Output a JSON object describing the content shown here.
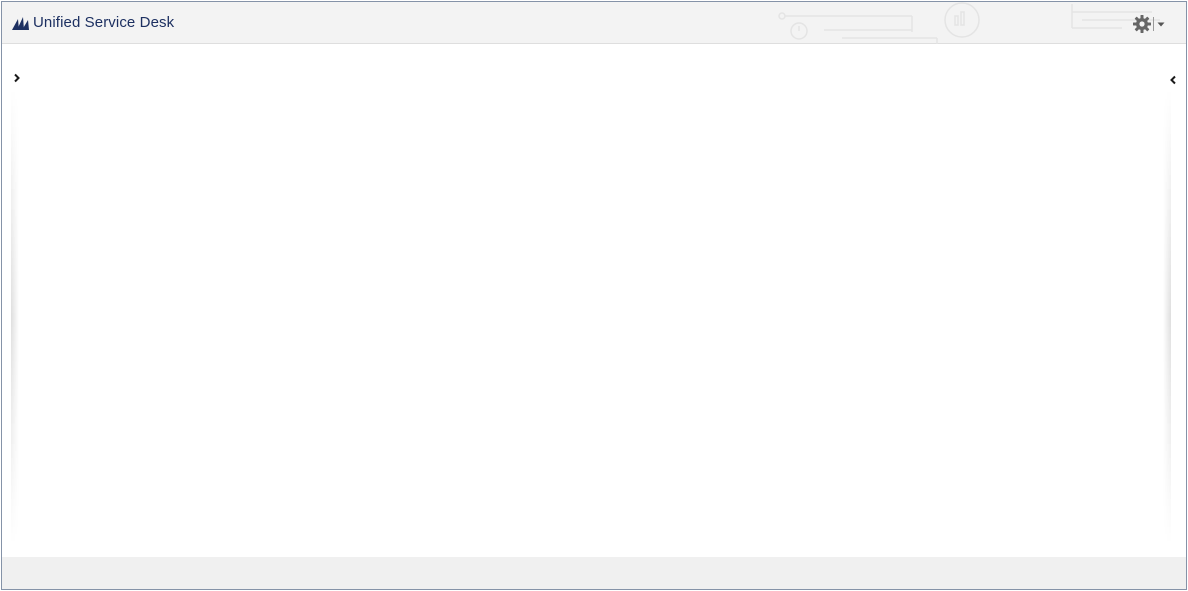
{
  "app": {
    "title": "Unified Service Desk",
    "brand_color": "#1d3061"
  },
  "header": {
    "logo_icon": "dynamics-logo-icon",
    "watermark": "circuit-watermark",
    "settings": {
      "icon": "gear-icon",
      "dropdown_icon": "caret-down-icon"
    }
  },
  "panels": {
    "left": {
      "toggle_icon": "chevron-right-icon",
      "state": "collapsed"
    },
    "right": {
      "toggle_icon": "chevron-left-icon",
      "state": "collapsed"
    }
  },
  "status_bar": {}
}
